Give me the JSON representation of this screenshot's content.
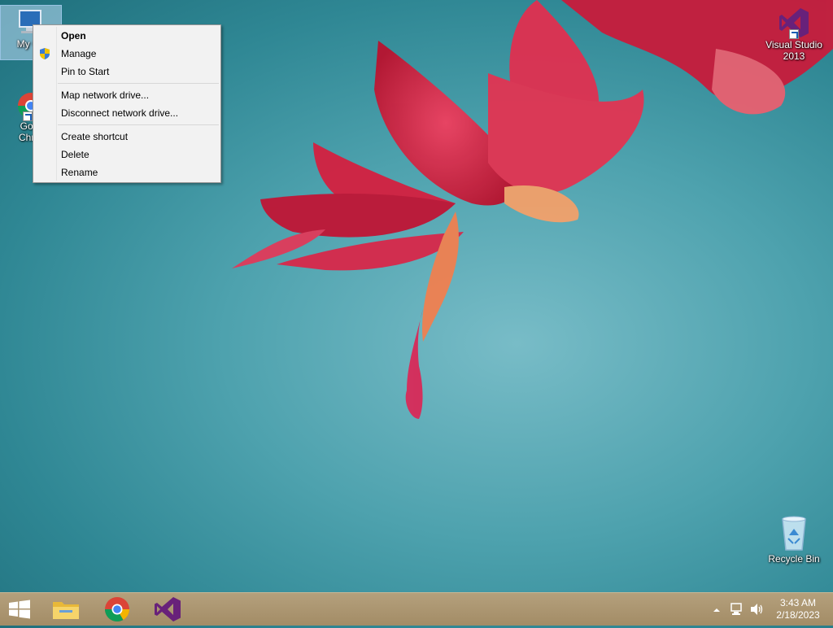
{
  "desktop": {
    "icons": {
      "my_computer": "My Co",
      "chrome_line1": "Goo",
      "chrome_line2": "Chro",
      "visual_studio_line1": "Visual Studio",
      "visual_studio_line2": "2013",
      "recycle_bin": "Recycle Bin"
    }
  },
  "context_menu": {
    "items": [
      {
        "label": "Open"
      },
      {
        "label": "Manage"
      },
      {
        "label": "Pin to Start"
      },
      {
        "label": "Map network drive..."
      },
      {
        "label": "Disconnect network drive..."
      },
      {
        "label": "Create shortcut"
      },
      {
        "label": "Delete"
      },
      {
        "label": "Rename"
      }
    ]
  },
  "taskbar": {
    "clock": {
      "time": "3:43 AM",
      "date": "2/18/2023"
    }
  },
  "colors": {
    "wallpaper_teal": "#4ea2ae",
    "flower_red": "#d8203c",
    "taskbar": "#a8926c",
    "vs_purple": "#68217a",
    "selection": "#bedcf5"
  },
  "icons": [
    "computer-icon",
    "chrome-icon",
    "visual-studio-icon",
    "recycle-bin-icon",
    "shield-icon",
    "start-icon",
    "file-explorer-icon",
    "network-icon",
    "volume-icon",
    "show-hidden-icons-icon"
  ]
}
